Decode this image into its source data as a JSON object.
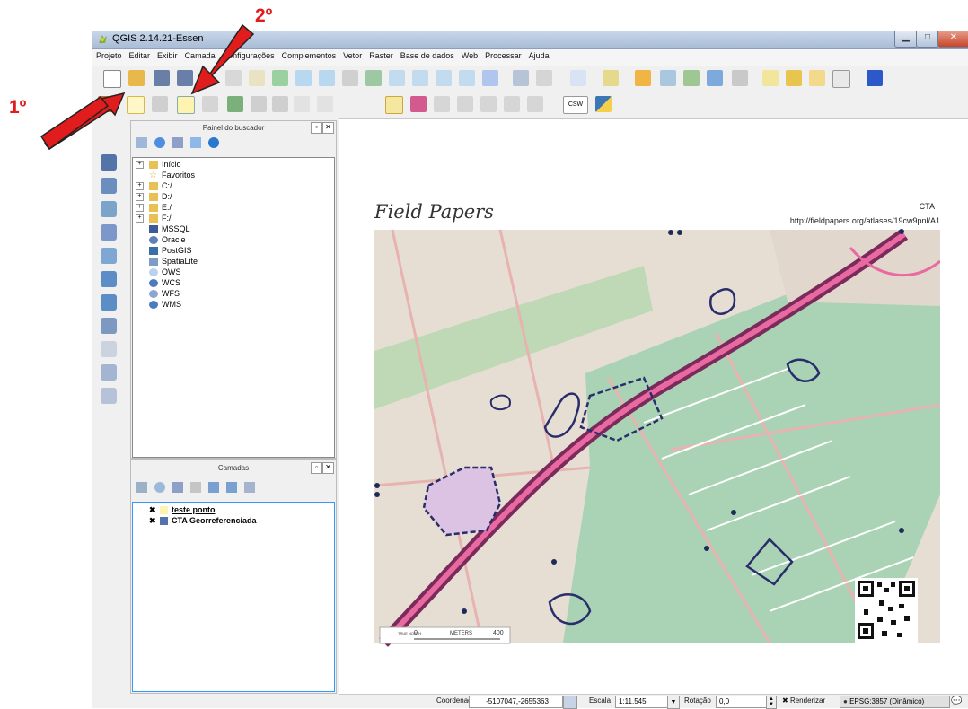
{
  "annotations": {
    "step1": "1º",
    "step2": "2º"
  },
  "window": {
    "title": "QGIS 2.14.21-Essen"
  },
  "menu": {
    "items": [
      "Projeto",
      "Editar",
      "Exibir",
      "Camada",
      "Configurações",
      "Complementos",
      "Vetor",
      "Raster",
      "Base de dados",
      "Web",
      "Processar",
      "Ajuda"
    ]
  },
  "toolbar": {
    "csw_label": "CSW"
  },
  "browser_panel": {
    "title": "Painel do buscador",
    "items": [
      "Início",
      "Favoritos",
      "C:/",
      "D:/",
      "E:/",
      "F:/",
      "MSSQL",
      "Oracle",
      "PostGIS",
      "SpatiaLite",
      "OWS",
      "WCS",
      "WFS",
      "WMS"
    ]
  },
  "layers_panel": {
    "title": "Camadas",
    "layers": [
      "teste ponto",
      "CTA Georreferenciada"
    ]
  },
  "map": {
    "brand": "Field Papers",
    "corner_label": "CTA",
    "url": "http://fieldpapers.org/atlases/19cw9pnl/A1",
    "scale_start": "0",
    "scale_unit": "METERS",
    "scale_end": "400",
    "north_label": "TRUE NORTH"
  },
  "statusbar": {
    "coord_label": "Coordenada",
    "coord_value": "-5107047,-2655363",
    "scale_label": "Escala",
    "scale_value": "1:11.545",
    "rotation_label": "Rotação",
    "rotation_value": "0,0",
    "render_label": "Renderizar",
    "crs_label": "EPSG:3857 (Dinâmico)"
  },
  "colors": {
    "annotation_red": "#e01c1c",
    "titlebar": "#b9cae1"
  }
}
